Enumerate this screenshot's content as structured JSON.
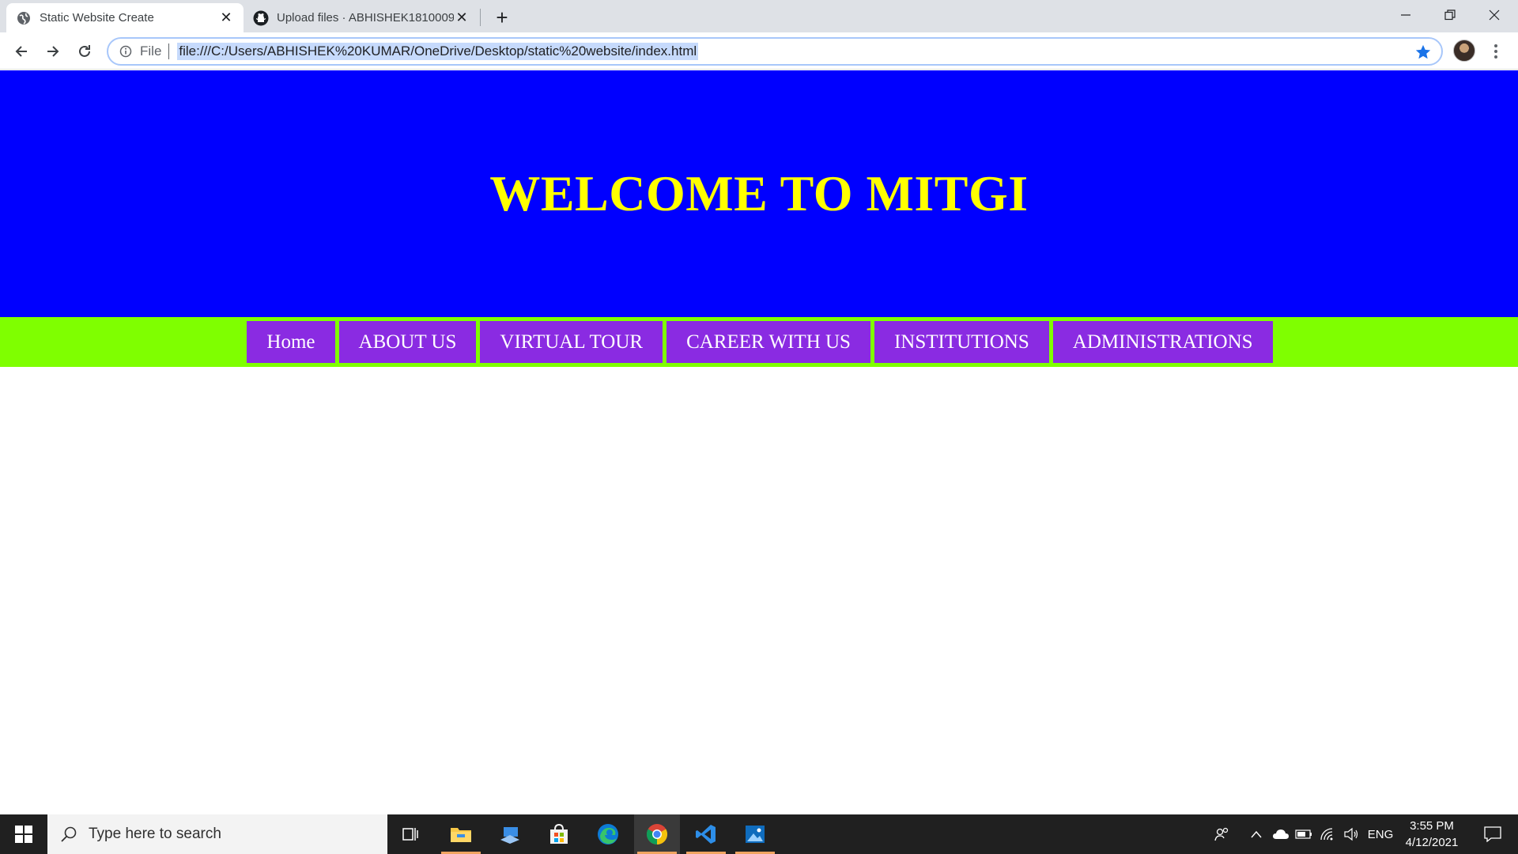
{
  "browser": {
    "tabs": [
      {
        "title": "Static Website Create",
        "favicon": "globe-icon",
        "active": true
      },
      {
        "title": "Upload files · ABHISHEK1810009/",
        "favicon": "github-icon",
        "active": false
      }
    ],
    "omnibox": {
      "scheme_label": "File",
      "url": "file:///C:/Users/ABHISHEK%20KUMAR/OneDrive/Desktop/static%20website/index.html"
    },
    "accent_color": "#1a73e8"
  },
  "page": {
    "banner": {
      "title": "WELCOME TO MITGI",
      "background": "#0000ff",
      "title_color": "#ffff00"
    },
    "nav": {
      "background": "#7fff00",
      "item_color": "#8a2be2",
      "items": [
        "Home",
        "ABOUT US",
        "VIRTUAL TOUR",
        "CAREER WITH US",
        "INSTITUTIONS",
        "ADMINISTRATIONS"
      ]
    }
  },
  "taskbar": {
    "search_placeholder": "Type here to search",
    "apps": [
      "task-view-icon",
      "file-explorer-icon",
      "remote-desktop-icon",
      "microsoft-store-icon",
      "edge-icon",
      "chrome-icon",
      "vscode-icon",
      "photos-icon"
    ],
    "tray": {
      "language": "ENG",
      "time": "3:55 PM",
      "date": "4/12/2021"
    }
  }
}
